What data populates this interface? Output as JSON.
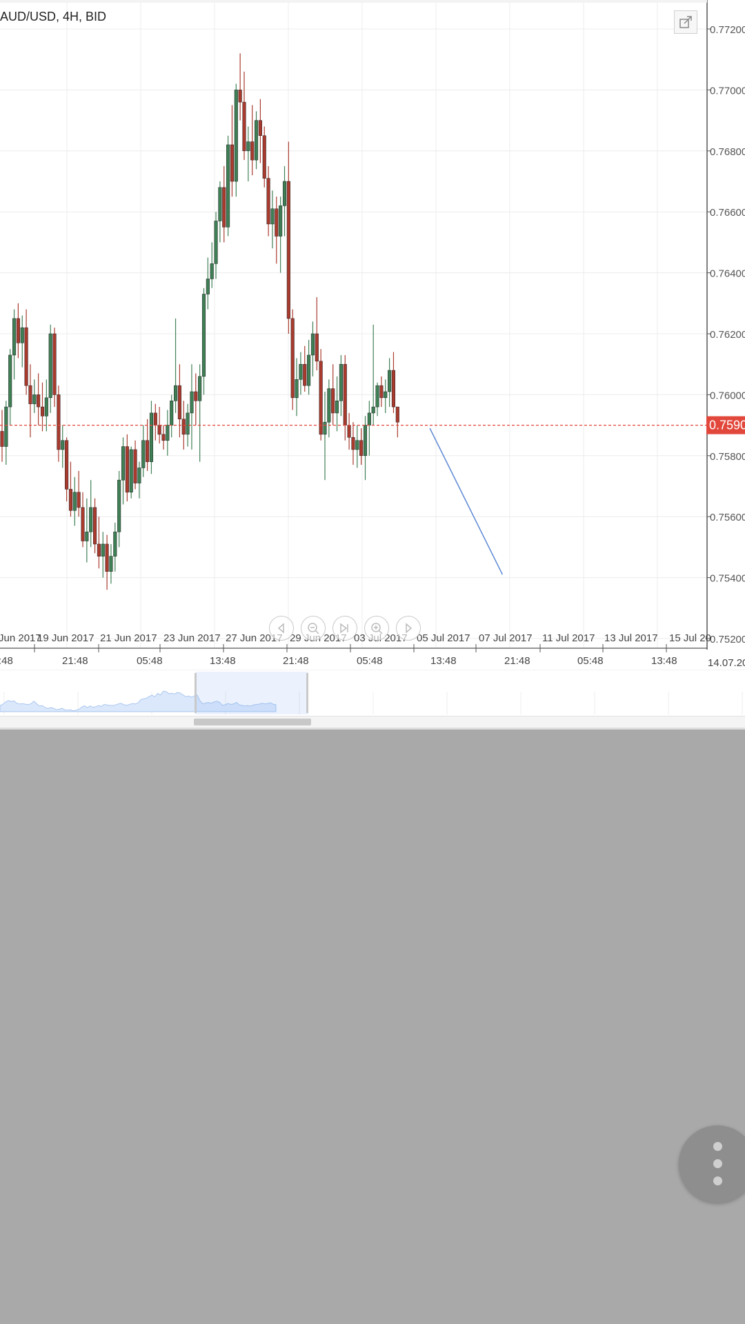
{
  "chart": {
    "title": "AUD/USD, 4H, BID",
    "current_price_label": "0.7590",
    "corner_label": "14.07.20",
    "price_ticks": [
      "0.77200",
      "0.77000",
      "0.76800",
      "0.76600",
      "0.76400",
      "0.76200",
      "0.76000",
      "0.75800",
      "0.75600",
      "0.75400",
      "0.75200"
    ],
    "date_labels": [
      "Jun 2017",
      "19 Jun 2017",
      "21 Jun 2017",
      "23 Jun 2017",
      "27 Jun 2017",
      "29 Jun 2017",
      "03 Jul 2017",
      "05 Jul 2017",
      "07 Jul 2017",
      "11 Jul 2017",
      "13 Jul 2017",
      "15 Jul 20"
    ],
    "time_labels": [
      ":48",
      "21:48",
      "05:48",
      "13:48",
      "21:48",
      "05:48",
      "13:48",
      "21:48",
      "05:48",
      "13:48"
    ]
  },
  "colors": {
    "bull": "#3f7f55",
    "bear": "#a83a2e",
    "price_line": "#e2473b",
    "trend_line": "#5b86d2",
    "grid": "#ececec",
    "navigator_fill": "#dbe8fb",
    "background": "#a9a9a9"
  },
  "icons": {
    "expand": "expand-icon",
    "nav_left": "chevron-left-icon",
    "zoom_out": "zoom-out-icon",
    "jump_end": "jump-to-end-icon",
    "zoom_in": "zoom-in-icon",
    "nav_right": "chevron-right-icon",
    "fab": "more-vertical-icon"
  },
  "chart_data": {
    "type": "candlestick",
    "title": "AUD/USD, 4H, BID",
    "ylim": [
      0.752,
      0.772
    ],
    "current_price": 0.759,
    "x_axis_dates": [
      "Jun 2017",
      "19 Jun 2017",
      "21 Jun 2017",
      "23 Jun 2017",
      "27 Jun 2017",
      "29 Jun 2017",
      "03 Jul 2017",
      "05 Jul 2017",
      "07 Jul 2017",
      "11 Jul 2017",
      "13 Jul 2017",
      "15 Jul 20"
    ],
    "candles": [
      {
        "o": 0.7588,
        "h": 0.7595,
        "l": 0.7578,
        "c": 0.7583
      },
      {
        "o": 0.7583,
        "h": 0.7598,
        "l": 0.7577,
        "c": 0.7596
      },
      {
        "o": 0.7596,
        "h": 0.7615,
        "l": 0.759,
        "c": 0.7613
      },
      {
        "o": 0.7613,
        "h": 0.7628,
        "l": 0.7605,
        "c": 0.7625
      },
      {
        "o": 0.7625,
        "h": 0.763,
        "l": 0.7612,
        "c": 0.7617
      },
      {
        "o": 0.7617,
        "h": 0.7626,
        "l": 0.7609,
        "c": 0.7622
      },
      {
        "o": 0.7622,
        "h": 0.7628,
        "l": 0.76,
        "c": 0.7603
      },
      {
        "o": 0.7603,
        "h": 0.761,
        "l": 0.7586,
        "c": 0.7597
      },
      {
        "o": 0.7597,
        "h": 0.7605,
        "l": 0.7594,
        "c": 0.76
      },
      {
        "o": 0.76,
        "h": 0.7607,
        "l": 0.759,
        "c": 0.7596
      },
      {
        "o": 0.7596,
        "h": 0.7604,
        "l": 0.7588,
        "c": 0.7593
      },
      {
        "o": 0.7593,
        "h": 0.7605,
        "l": 0.7588,
        "c": 0.7599
      },
      {
        "o": 0.7599,
        "h": 0.7623,
        "l": 0.7594,
        "c": 0.762
      },
      {
        "o": 0.762,
        "h": 0.7622,
        "l": 0.7596,
        "c": 0.76
      },
      {
        "o": 0.76,
        "h": 0.7603,
        "l": 0.7578,
        "c": 0.7582
      },
      {
        "o": 0.7582,
        "h": 0.759,
        "l": 0.7576,
        "c": 0.7585
      },
      {
        "o": 0.7585,
        "h": 0.7586,
        "l": 0.7565,
        "c": 0.7569
      },
      {
        "o": 0.7569,
        "h": 0.7578,
        "l": 0.756,
        "c": 0.7562
      },
      {
        "o": 0.7562,
        "h": 0.7573,
        "l": 0.7557,
        "c": 0.7568
      },
      {
        "o": 0.7568,
        "h": 0.7575,
        "l": 0.756,
        "c": 0.7563
      },
      {
        "o": 0.7563,
        "h": 0.7568,
        "l": 0.755,
        "c": 0.7552
      },
      {
        "o": 0.7552,
        "h": 0.7566,
        "l": 0.7545,
        "c": 0.7555
      },
      {
        "o": 0.7555,
        "h": 0.7572,
        "l": 0.755,
        "c": 0.7563
      },
      {
        "o": 0.7563,
        "h": 0.7566,
        "l": 0.7548,
        "c": 0.7551
      },
      {
        "o": 0.7551,
        "h": 0.756,
        "l": 0.7543,
        "c": 0.7547
      },
      {
        "o": 0.7547,
        "h": 0.7555,
        "l": 0.754,
        "c": 0.7551
      },
      {
        "o": 0.7551,
        "h": 0.7554,
        "l": 0.7536,
        "c": 0.7542
      },
      {
        "o": 0.7542,
        "h": 0.7551,
        "l": 0.7538,
        "c": 0.7547
      },
      {
        "o": 0.7547,
        "h": 0.7558,
        "l": 0.7542,
        "c": 0.7555
      },
      {
        "o": 0.7555,
        "h": 0.7575,
        "l": 0.755,
        "c": 0.7572
      },
      {
        "o": 0.7572,
        "h": 0.7586,
        "l": 0.7564,
        "c": 0.7583
      },
      {
        "o": 0.7583,
        "h": 0.7587,
        "l": 0.7565,
        "c": 0.7568
      },
      {
        "o": 0.7568,
        "h": 0.7583,
        "l": 0.7566,
        "c": 0.7582
      },
      {
        "o": 0.7582,
        "h": 0.7585,
        "l": 0.7569,
        "c": 0.7571
      },
      {
        "o": 0.7571,
        "h": 0.7578,
        "l": 0.7566,
        "c": 0.7576
      },
      {
        "o": 0.7576,
        "h": 0.759,
        "l": 0.7573,
        "c": 0.7585
      },
      {
        "o": 0.7585,
        "h": 0.7592,
        "l": 0.7575,
        "c": 0.7578
      },
      {
        "o": 0.7578,
        "h": 0.7598,
        "l": 0.7574,
        "c": 0.7594
      },
      {
        "o": 0.7594,
        "h": 0.7597,
        "l": 0.7585,
        "c": 0.759
      },
      {
        "o": 0.759,
        "h": 0.7596,
        "l": 0.7584,
        "c": 0.7587
      },
      {
        "o": 0.7587,
        "h": 0.759,
        "l": 0.7582,
        "c": 0.7585
      },
      {
        "o": 0.7585,
        "h": 0.7595,
        "l": 0.758,
        "c": 0.759
      },
      {
        "o": 0.759,
        "h": 0.76,
        "l": 0.7586,
        "c": 0.7598
      },
      {
        "o": 0.7598,
        "h": 0.7625,
        "l": 0.7594,
        "c": 0.7603
      },
      {
        "o": 0.7603,
        "h": 0.761,
        "l": 0.7586,
        "c": 0.7592
      },
      {
        "o": 0.7592,
        "h": 0.7598,
        "l": 0.7582,
        "c": 0.7587
      },
      {
        "o": 0.7587,
        "h": 0.7597,
        "l": 0.7583,
        "c": 0.7594
      },
      {
        "o": 0.7594,
        "h": 0.761,
        "l": 0.7582,
        "c": 0.7601
      },
      {
        "o": 0.7601,
        "h": 0.7607,
        "l": 0.759,
        "c": 0.7598
      },
      {
        "o": 0.7598,
        "h": 0.761,
        "l": 0.7578,
        "c": 0.7606
      },
      {
        "o": 0.7606,
        "h": 0.7635,
        "l": 0.76,
        "c": 0.7633
      },
      {
        "o": 0.7633,
        "h": 0.7645,
        "l": 0.7628,
        "c": 0.7638
      },
      {
        "o": 0.7638,
        "h": 0.765,
        "l": 0.7635,
        "c": 0.7643
      },
      {
        "o": 0.7643,
        "h": 0.766,
        "l": 0.7638,
        "c": 0.7657
      },
      {
        "o": 0.7657,
        "h": 0.767,
        "l": 0.765,
        "c": 0.7668
      },
      {
        "o": 0.7668,
        "h": 0.7675,
        "l": 0.765,
        "c": 0.7655
      },
      {
        "o": 0.7655,
        "h": 0.7685,
        "l": 0.7652,
        "c": 0.7682
      },
      {
        "o": 0.7682,
        "h": 0.7695,
        "l": 0.7665,
        "c": 0.767
      },
      {
        "o": 0.767,
        "h": 0.7702,
        "l": 0.7665,
        "c": 0.77
      },
      {
        "o": 0.77,
        "h": 0.7712,
        "l": 0.769,
        "c": 0.7696
      },
      {
        "o": 0.7696,
        "h": 0.7706,
        "l": 0.7677,
        "c": 0.768
      },
      {
        "o": 0.768,
        "h": 0.7688,
        "l": 0.767,
        "c": 0.7683
      },
      {
        "o": 0.7683,
        "h": 0.7695,
        "l": 0.7672,
        "c": 0.7677
      },
      {
        "o": 0.7677,
        "h": 0.7693,
        "l": 0.7674,
        "c": 0.769
      },
      {
        "o": 0.769,
        "h": 0.7697,
        "l": 0.7676,
        "c": 0.7685
      },
      {
        "o": 0.7685,
        "h": 0.7688,
        "l": 0.7668,
        "c": 0.7671
      },
      {
        "o": 0.7671,
        "h": 0.7675,
        "l": 0.7652,
        "c": 0.7656
      },
      {
        "o": 0.7656,
        "h": 0.7667,
        "l": 0.7648,
        "c": 0.7661
      },
      {
        "o": 0.7661,
        "h": 0.7665,
        "l": 0.7643,
        "c": 0.7652
      },
      {
        "o": 0.7652,
        "h": 0.7665,
        "l": 0.764,
        "c": 0.7662
      },
      {
        "o": 0.7662,
        "h": 0.7675,
        "l": 0.7652,
        "c": 0.767
      },
      {
        "o": 0.767,
        "h": 0.7683,
        "l": 0.762,
        "c": 0.7625
      },
      {
        "o": 0.7625,
        "h": 0.7628,
        "l": 0.7595,
        "c": 0.7599
      },
      {
        "o": 0.7599,
        "h": 0.7612,
        "l": 0.7593,
        "c": 0.7605
      },
      {
        "o": 0.7605,
        "h": 0.7614,
        "l": 0.76,
        "c": 0.761
      },
      {
        "o": 0.761,
        "h": 0.7616,
        "l": 0.7601,
        "c": 0.7603
      },
      {
        "o": 0.7603,
        "h": 0.7618,
        "l": 0.76,
        "c": 0.7613
      },
      {
        "o": 0.7613,
        "h": 0.7624,
        "l": 0.7606,
        "c": 0.762
      },
      {
        "o": 0.762,
        "h": 0.7632,
        "l": 0.7608,
        "c": 0.7611
      },
      {
        "o": 0.7611,
        "h": 0.7615,
        "l": 0.7585,
        "c": 0.7587
      },
      {
        "o": 0.7587,
        "h": 0.7601,
        "l": 0.7572,
        "c": 0.7591
      },
      {
        "o": 0.7591,
        "h": 0.7605,
        "l": 0.7586,
        "c": 0.7602
      },
      {
        "o": 0.7602,
        "h": 0.761,
        "l": 0.759,
        "c": 0.7594
      },
      {
        "o": 0.7594,
        "h": 0.7606,
        "l": 0.7588,
        "c": 0.7598
      },
      {
        "o": 0.7598,
        "h": 0.7613,
        "l": 0.7593,
        "c": 0.761
      },
      {
        "o": 0.761,
        "h": 0.7613,
        "l": 0.7585,
        "c": 0.759
      },
      {
        "o": 0.759,
        "h": 0.7594,
        "l": 0.7582,
        "c": 0.7586
      },
      {
        "o": 0.7586,
        "h": 0.7591,
        "l": 0.7577,
        "c": 0.7582
      },
      {
        "o": 0.7582,
        "h": 0.759,
        "l": 0.7576,
        "c": 0.7585
      },
      {
        "o": 0.7585,
        "h": 0.7589,
        "l": 0.7577,
        "c": 0.758
      },
      {
        "o": 0.758,
        "h": 0.7593,
        "l": 0.7572,
        "c": 0.759
      },
      {
        "o": 0.759,
        "h": 0.7598,
        "l": 0.758,
        "c": 0.7594
      },
      {
        "o": 0.7594,
        "h": 0.7623,
        "l": 0.759,
        "c": 0.7596
      },
      {
        "o": 0.7596,
        "h": 0.7604,
        "l": 0.7593,
        "c": 0.7603
      },
      {
        "o": 0.7603,
        "h": 0.7606,
        "l": 0.7596,
        "c": 0.7599
      },
      {
        "o": 0.7599,
        "h": 0.7605,
        "l": 0.7594,
        "c": 0.7601
      },
      {
        "o": 0.7601,
        "h": 0.7612,
        "l": 0.7596,
        "c": 0.7608
      },
      {
        "o": 0.7608,
        "h": 0.7614,
        "l": 0.7594,
        "c": 0.7596
      },
      {
        "o": 0.7596,
        "h": 0.7596,
        "l": 0.7586,
        "c": 0.7591
      }
    ],
    "trendline": {
      "from": {
        "candle_index": 106,
        "price": 0.7589
      },
      "to": {
        "candle_index": 124,
        "price": 0.7541
      }
    },
    "grid": true
  }
}
